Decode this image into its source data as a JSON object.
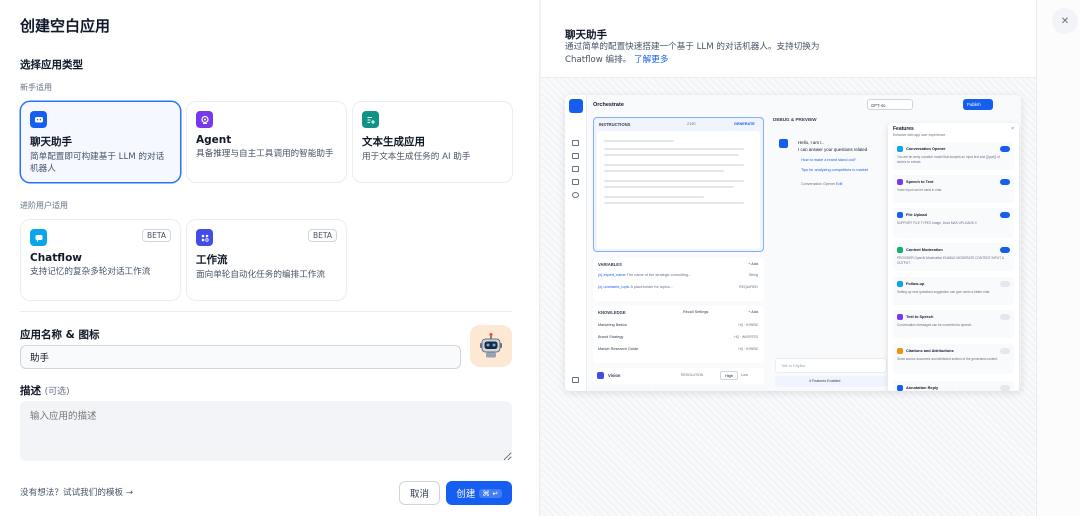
{
  "header": {
    "title": "创建空白应用"
  },
  "app_type": {
    "section_title": "选择应用类型",
    "beginner_label": "新手适用",
    "advanced_label": "进阶用户适用",
    "cards": [
      {
        "name": "聊天助手",
        "desc": "简单配置即可构建基于 LLM 的对话机器人",
        "icon": "chat-bot-icon",
        "color": "#155eef"
      },
      {
        "name": "Agent",
        "desc": "具备推理与自主工具调用的智能助手",
        "icon": "agent-icon",
        "color": "#7839ee"
      },
      {
        "name": "文本生成应用",
        "desc": "用于文本生成任务的 AI 助手",
        "icon": "text-generation-icon",
        "color": "#0e9384"
      },
      {
        "name": "Chatflow",
        "desc": "支持记忆的复杂多轮对话工作流",
        "icon": "chatflow-icon",
        "color": "#0ba5ec",
        "badge": "BETA"
      },
      {
        "name": "工作流",
        "desc": "面向单轮自动化任务的编排工作流",
        "icon": "workflow-icon",
        "color": "#444ce7",
        "badge": "BETA"
      }
    ]
  },
  "name_section": {
    "label": "应用名称 & 图标",
    "value": "助手",
    "avatar_icon": "robot-avatar-icon"
  },
  "description_section": {
    "label": "描述",
    "optional": "(可选)",
    "placeholder": "输入应用的描述"
  },
  "footer": {
    "template_link": "没有想法？试试我们的模板 →",
    "cancel_label": "取消",
    "create_label": "创建",
    "create_shortcut": "⌘ ↵"
  },
  "preview": {
    "title": "聊天助手",
    "desc": "通过简单的配置快速搭建一个基于 LLM 的对话机器人。支持切换为 Chatflow 编排。",
    "learn_more": "了解更多",
    "close_icon": "close-icon",
    "mock": {
      "title": "Orchestrate",
      "model": "GPT-4o",
      "publish": "Publish",
      "instructions_label": "INSTRUCTIONS",
      "instructions_count": "2190",
      "generate": "GENERATE",
      "variables_label": "VARIABLES",
      "add_label": "+ Add",
      "variables": [
        {
          "key": "{x} expert_name",
          "desc": "The name of the strategic consulting...",
          "type": "String"
        },
        {
          "key": "{x} unrelated_topic",
          "desc": "A placeholder for topics...",
          "type": "REQUIRED"
        }
      ],
      "knowledge_label": "KNOWLEDGE",
      "recall_settings": "Recall Settings",
      "knowledge": [
        {
          "name": "Marketing Basics",
          "tag": "HQ · HYBRID"
        },
        {
          "name": "Brand Strategy",
          "tag": "HQ · INVERTED"
        },
        {
          "name": "Market Research Guide",
          "tag": "HQ · HYBRID"
        }
      ],
      "vision_label": "Vision",
      "resolution_label": "RESOLUTION",
      "high": "High",
      "low": "Low",
      "debug_title": "DEBUG & PREVIEW",
      "chat_greeting": "Hello, I am I..",
      "chat_line2": "I can answer your questions related",
      "chat_suggest1": "How to make a brand stand out?",
      "chat_suggest2": "Tips for analyzing competitors in market",
      "conv_opener": "Conversation Opener",
      "edit_label": "Edit",
      "talk_placeholder": "Talk to DifyBot",
      "features_enabled": "4 Features Enabled",
      "features": {
        "title": "Features",
        "subtitle": "Enhance web app user experience",
        "items": [
          {
            "name": "Conversation Opener",
            "desc": "You are an army vocation model that accepts an input text and {{type}} of stories to extract.",
            "on": true,
            "color": "#0ba5ec"
          },
          {
            "name": "Speech to Text",
            "desc": "Voice input can be used in chat.",
            "on": true,
            "color": "#7839ee"
          },
          {
            "name": "File Upload",
            "desc": "SUPPORT FILE TYPES  Image, Docs   MAX UPLOADS  3",
            "on": true,
            "color": "#155eef"
          },
          {
            "name": "Content Moderation",
            "desc": "PROVIDER  OpenAI Moderation   ENABLE MODERATE CONTENT  INPUT & OUTPUT",
            "on": true,
            "color": "#17b26a"
          },
          {
            "name": "Follow-up",
            "desc": "Setting up next questions suggestion can give users a better chat.",
            "on": false,
            "color": "#0ba5ec"
          },
          {
            "name": "Text to Speech",
            "desc": "Conversation messages can be converted to speech.",
            "on": false,
            "color": "#7839ee"
          },
          {
            "name": "Citations and Attributions",
            "desc": "Show source document and attributed section of the generated content.",
            "on": false,
            "color": "#f79009"
          },
          {
            "name": "Annotation Reply",
            "desc": "",
            "on": false,
            "color": "#155eef"
          }
        ]
      }
    }
  }
}
